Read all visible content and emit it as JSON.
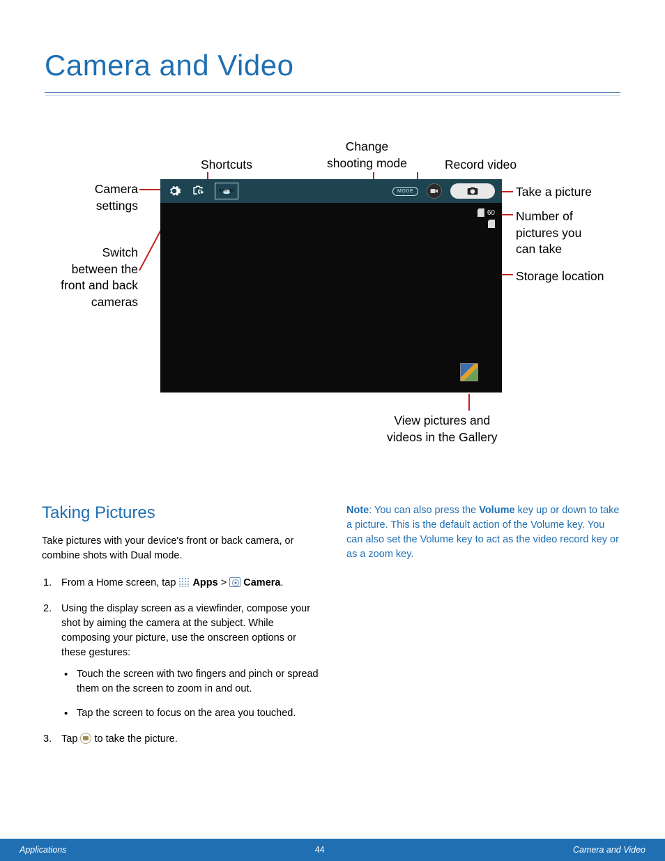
{
  "page_title": "Camera and Video",
  "diagram": {
    "labels": {
      "shortcuts": "Shortcuts",
      "change_mode": "Change\nshooting mode",
      "record_video": "Record video",
      "camera_settings": "Camera\nsettings",
      "take_picture": "Take a picture",
      "num_pictures": "Number of\npictures you\ncan take",
      "switch_cameras": "Switch\nbetween the\nfront and back\ncameras",
      "storage_location": "Storage location",
      "view_gallery": "View pictures and\nvideos in the Gallery"
    },
    "topbar": {
      "mode_label": "MODE",
      "hdr_label": "HDR ON",
      "picture_count": "60"
    }
  },
  "section_heading": "Taking Pictures",
  "intro": "Take pictures with your device's front or back camera, or combine shots with Dual mode.",
  "steps": {
    "s1_pre": "From a Home screen, tap ",
    "s1_apps": "Apps",
    "s1_gt": " > ",
    "s1_camera": "Camera",
    "s1_post": ".",
    "s2": "Using the display screen as a viewfinder, compose your shot by aiming the camera at the subject. While composing your picture, use the onscreen options or these gestures:",
    "bullets": [
      "Touch the screen with two fingers and pinch or spread them on the screen to zoom in and out.",
      "Tap the screen to focus on the area you touched."
    ],
    "s3_pre": "Tap ",
    "s3_post": " to take the picture."
  },
  "note": {
    "prefix": "Note",
    "t1": ": You can also press the ",
    "volume": "Volume",
    "t2": " key up or down to take a picture. This is the default action of the Volume key. You can also set the Volume key to act as the video record key or as a zoom key."
  },
  "footer": {
    "left": "Applications",
    "center": "44",
    "right": "Camera and Video"
  }
}
